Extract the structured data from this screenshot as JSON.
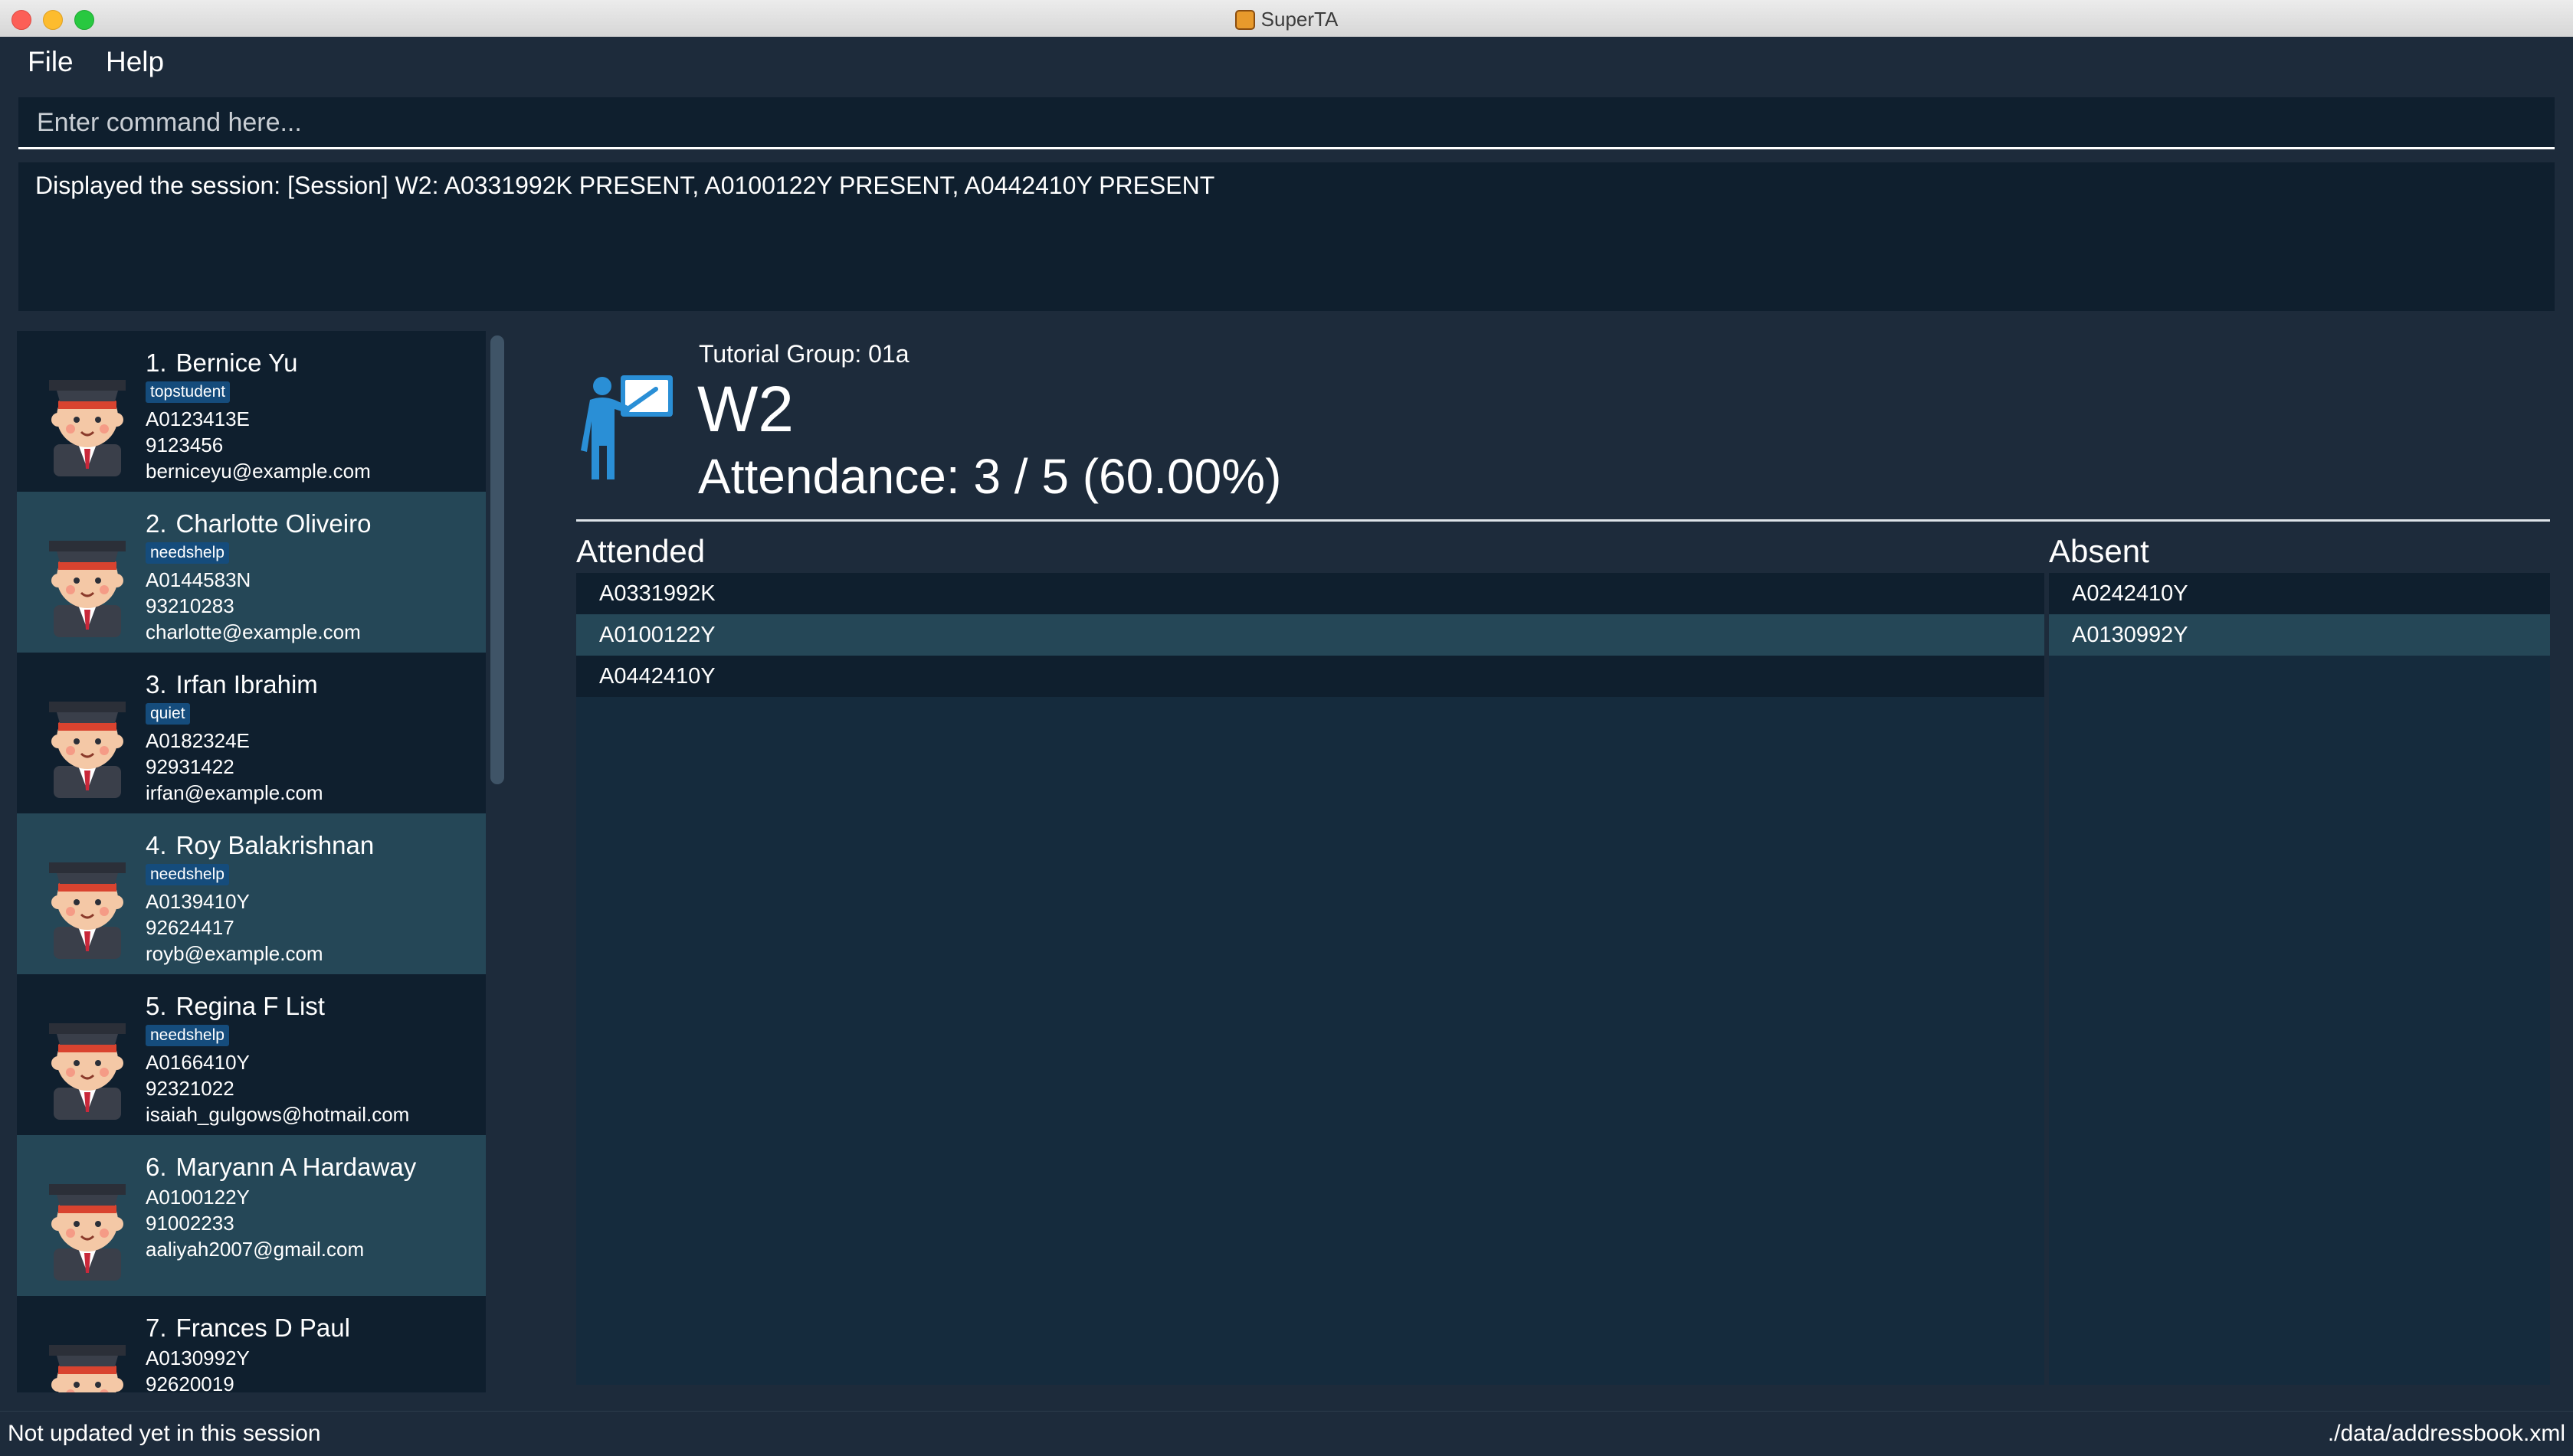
{
  "window": {
    "title": "SuperTA"
  },
  "menu": {
    "items": [
      "File",
      "Help"
    ]
  },
  "command_box": {
    "placeholder": "Enter command here..."
  },
  "result_display": {
    "text": "Displayed the session: [Session] W2: A0331992K PRESENT, A0100122Y PRESENT, A0442410Y PRESENT"
  },
  "students": [
    {
      "index": "1.",
      "name": "Bernice Yu",
      "tag": "topstudent",
      "id": "A0123413E",
      "phone": "9123456",
      "email": "berniceyu@example.com"
    },
    {
      "index": "2.",
      "name": "Charlotte Oliveiro",
      "tag": "needshelp",
      "id": "A0144583N",
      "phone": "93210283",
      "email": "charlotte@example.com"
    },
    {
      "index": "3.",
      "name": "Irfan Ibrahim",
      "tag": "quiet",
      "id": "A0182324E",
      "phone": "92931422",
      "email": "irfan@example.com"
    },
    {
      "index": "4.",
      "name": "Roy Balakrishnan",
      "tag": "needshelp",
      "id": "A0139410Y",
      "phone": "92624417",
      "email": "royb@example.com"
    },
    {
      "index": "5.",
      "name": "Regina F List",
      "tag": "needshelp",
      "id": "A0166410Y",
      "phone": "92321022",
      "email": "isaiah_gulgows@hotmail.com"
    },
    {
      "index": "6.",
      "name": "Maryann A Hardaway",
      "tag": "",
      "id": "A0100122Y",
      "phone": "91002233",
      "email": "aaliyah2007@gmail.com"
    },
    {
      "index": "7.",
      "name": "Frances D Paul",
      "tag": "",
      "id": "A0130992Y",
      "phone": "92620019",
      "email": ""
    }
  ],
  "session": {
    "group_label": "Tutorial Group: 01a",
    "name": "W2",
    "attendance": "Attendance: 3 / 5 (60.00%)",
    "attended_title": "Attended",
    "absent_title": "Absent",
    "attended": [
      "A0331992K",
      "A0100122Y",
      "A0442410Y"
    ],
    "absent": [
      "A0242410Y",
      "A0130992Y"
    ]
  },
  "status_bar": {
    "left": "Not updated yet in this session",
    "right": "./data/addressbook.xml"
  },
  "colors": {
    "background": "#1d2b3b",
    "card_dark": "#0f1f2e",
    "card_light": "#254757",
    "tag": "#154c7c",
    "teacher_icon": "#2a8fd6"
  }
}
